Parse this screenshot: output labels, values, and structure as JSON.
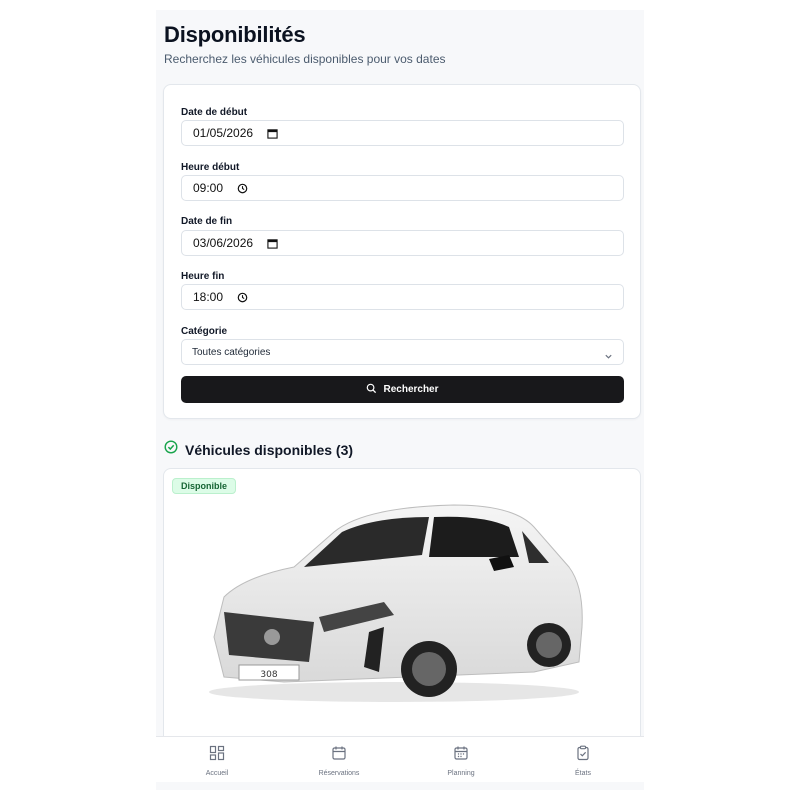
{
  "header": {
    "title": "Disponibilités",
    "subtitle": "Recherchez les véhicules disponibles pour vos dates"
  },
  "form": {
    "start_date": {
      "label": "Date de début",
      "value": "01/05/2026"
    },
    "start_time": {
      "label": "Heure début",
      "value": "09:00"
    },
    "end_date": {
      "label": "Date de fin",
      "value": "03/06/2026"
    },
    "end_time": {
      "label": "Heure fin",
      "value": "18:00"
    },
    "category": {
      "label": "Catégorie",
      "value": "Toutes catégories"
    },
    "search_label": "Rechercher"
  },
  "results": {
    "title": "Véhicules disponibles (3)",
    "vehicles": [
      {
        "status": "Disponible",
        "plate": "308"
      }
    ]
  },
  "nav": {
    "items": [
      {
        "label": "Accueil",
        "icon": "dashboard-icon"
      },
      {
        "label": "Réservations",
        "icon": "calendar-icon"
      },
      {
        "label": "Planning",
        "icon": "calendar-grid-icon"
      },
      {
        "label": "États",
        "icon": "clipboard-check-icon"
      }
    ]
  },
  "colors": {
    "primary_button": "#18181b",
    "status_green": "#166534",
    "status_bg": "#dcfce7",
    "background": "#f7f8fa"
  }
}
